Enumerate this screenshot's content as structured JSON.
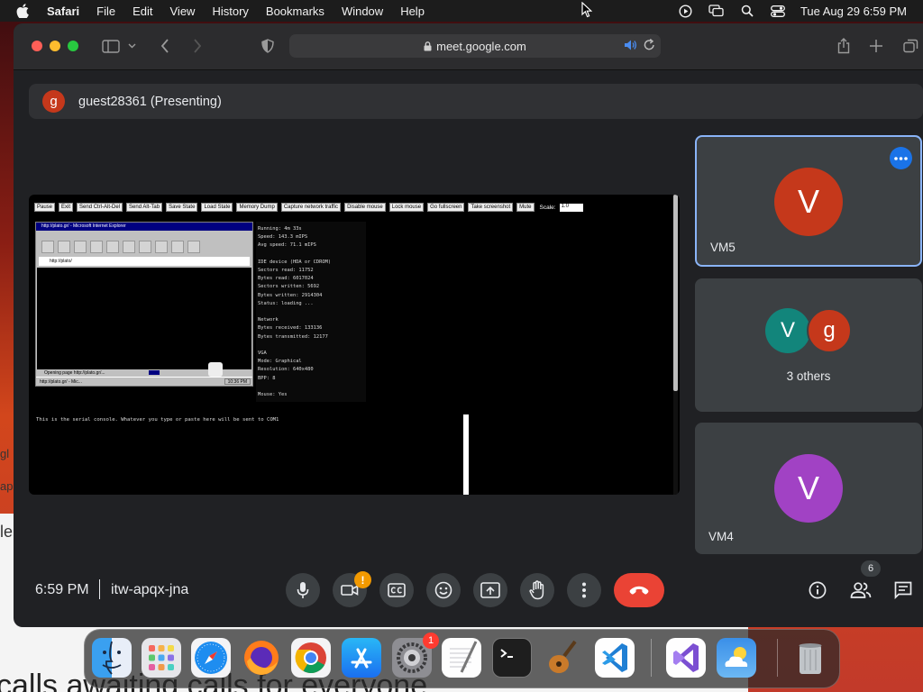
{
  "menubar": {
    "app_name": "Safari",
    "items": [
      "File",
      "Edit",
      "View",
      "History",
      "Bookmarks",
      "Window",
      "Help"
    ],
    "clock": "Tue Aug 29  6:59 PM"
  },
  "browser": {
    "url": "meet.google.com"
  },
  "meet": {
    "presenter": {
      "initial": "g",
      "name": "guest28361 (Presenting)"
    },
    "tiles": [
      {
        "initial": "V",
        "name": "VM5",
        "avatar_color": "#c5381b"
      },
      {
        "initials": [
          "V",
          "g"
        ],
        "label": "3 others",
        "avatar_colors": [
          "#12857b",
          "#c5381b"
        ]
      },
      {
        "initial": "V",
        "name": "VM4",
        "avatar_color": "#a142c4"
      }
    ],
    "time": "6:59 PM",
    "meeting_code": "itw-apqx-jna",
    "people_count": "6",
    "camera_warning": "!",
    "hangup_color": "#ea4335",
    "accent_color": "#8ab4f8"
  },
  "shared_screen": {
    "buttons": [
      "Pause",
      "Exit",
      "Send Ctrl-Alt-Del",
      "Send Alt-Tab",
      "Save State",
      "Load State",
      "Memory Dump",
      "Capture network traffic",
      "Disable mouse",
      "Lock mouse",
      "Go fullscreen",
      "Take screenshot",
      "Mute"
    ],
    "scale_label": "Scale:",
    "scale_value": "1.0",
    "ie_title": "http://plato.gr/ - Microsoft Internet Explorer",
    "ie_address": "http://plato/",
    "ie_status": "Opening page http://plato.gr/...",
    "ie_task": "http://plato.gr/ - Mic...",
    "ie_time": "10:36 PM",
    "stats": {
      "running": "Running: 4m 33s",
      "speed": "Speed: 143.3 mIPS",
      "avg_speed": "Avg speed: 71.1 mIPS",
      "ide_title": "IDE device (HDA or CDROM)",
      "sectors_read": "Sectors read: 11752",
      "bytes_read": "Bytes read: 6017024",
      "sectors_written": "Sectors written: 5692",
      "bytes_written": "Bytes written: 2914304",
      "status": "Status: loading ...",
      "network_title": "Network",
      "bytes_received": "Bytes received: 133136",
      "bytes_transmitted": "Bytes transmitted: 12177",
      "vga_title": "VGA",
      "mode": "Mode: Graphical",
      "resolution": "Resolution: 640x480",
      "bpp": "BPP: 8",
      "mouse": "Mouse: Yes"
    },
    "serial_text": "This is the serial console. Whatever you type or paste here will be sent to COM1"
  },
  "dock": {
    "apps": [
      "finder-icon",
      "launchpad-icon",
      "safari-icon",
      "firefox-icon",
      "chrome-icon",
      "app-store-icon",
      "system-settings-icon",
      "textedit-icon",
      "terminal-icon",
      "garageband-icon",
      "vscode-icon",
      "visual-studio-icon",
      "weather-icon",
      "trash-icon"
    ],
    "settings_badge": "1"
  },
  "background": {
    "text": "calls awaiting calls for everyone",
    "frag1": "gl",
    "frag2": "app",
    "frag3": "le"
  }
}
